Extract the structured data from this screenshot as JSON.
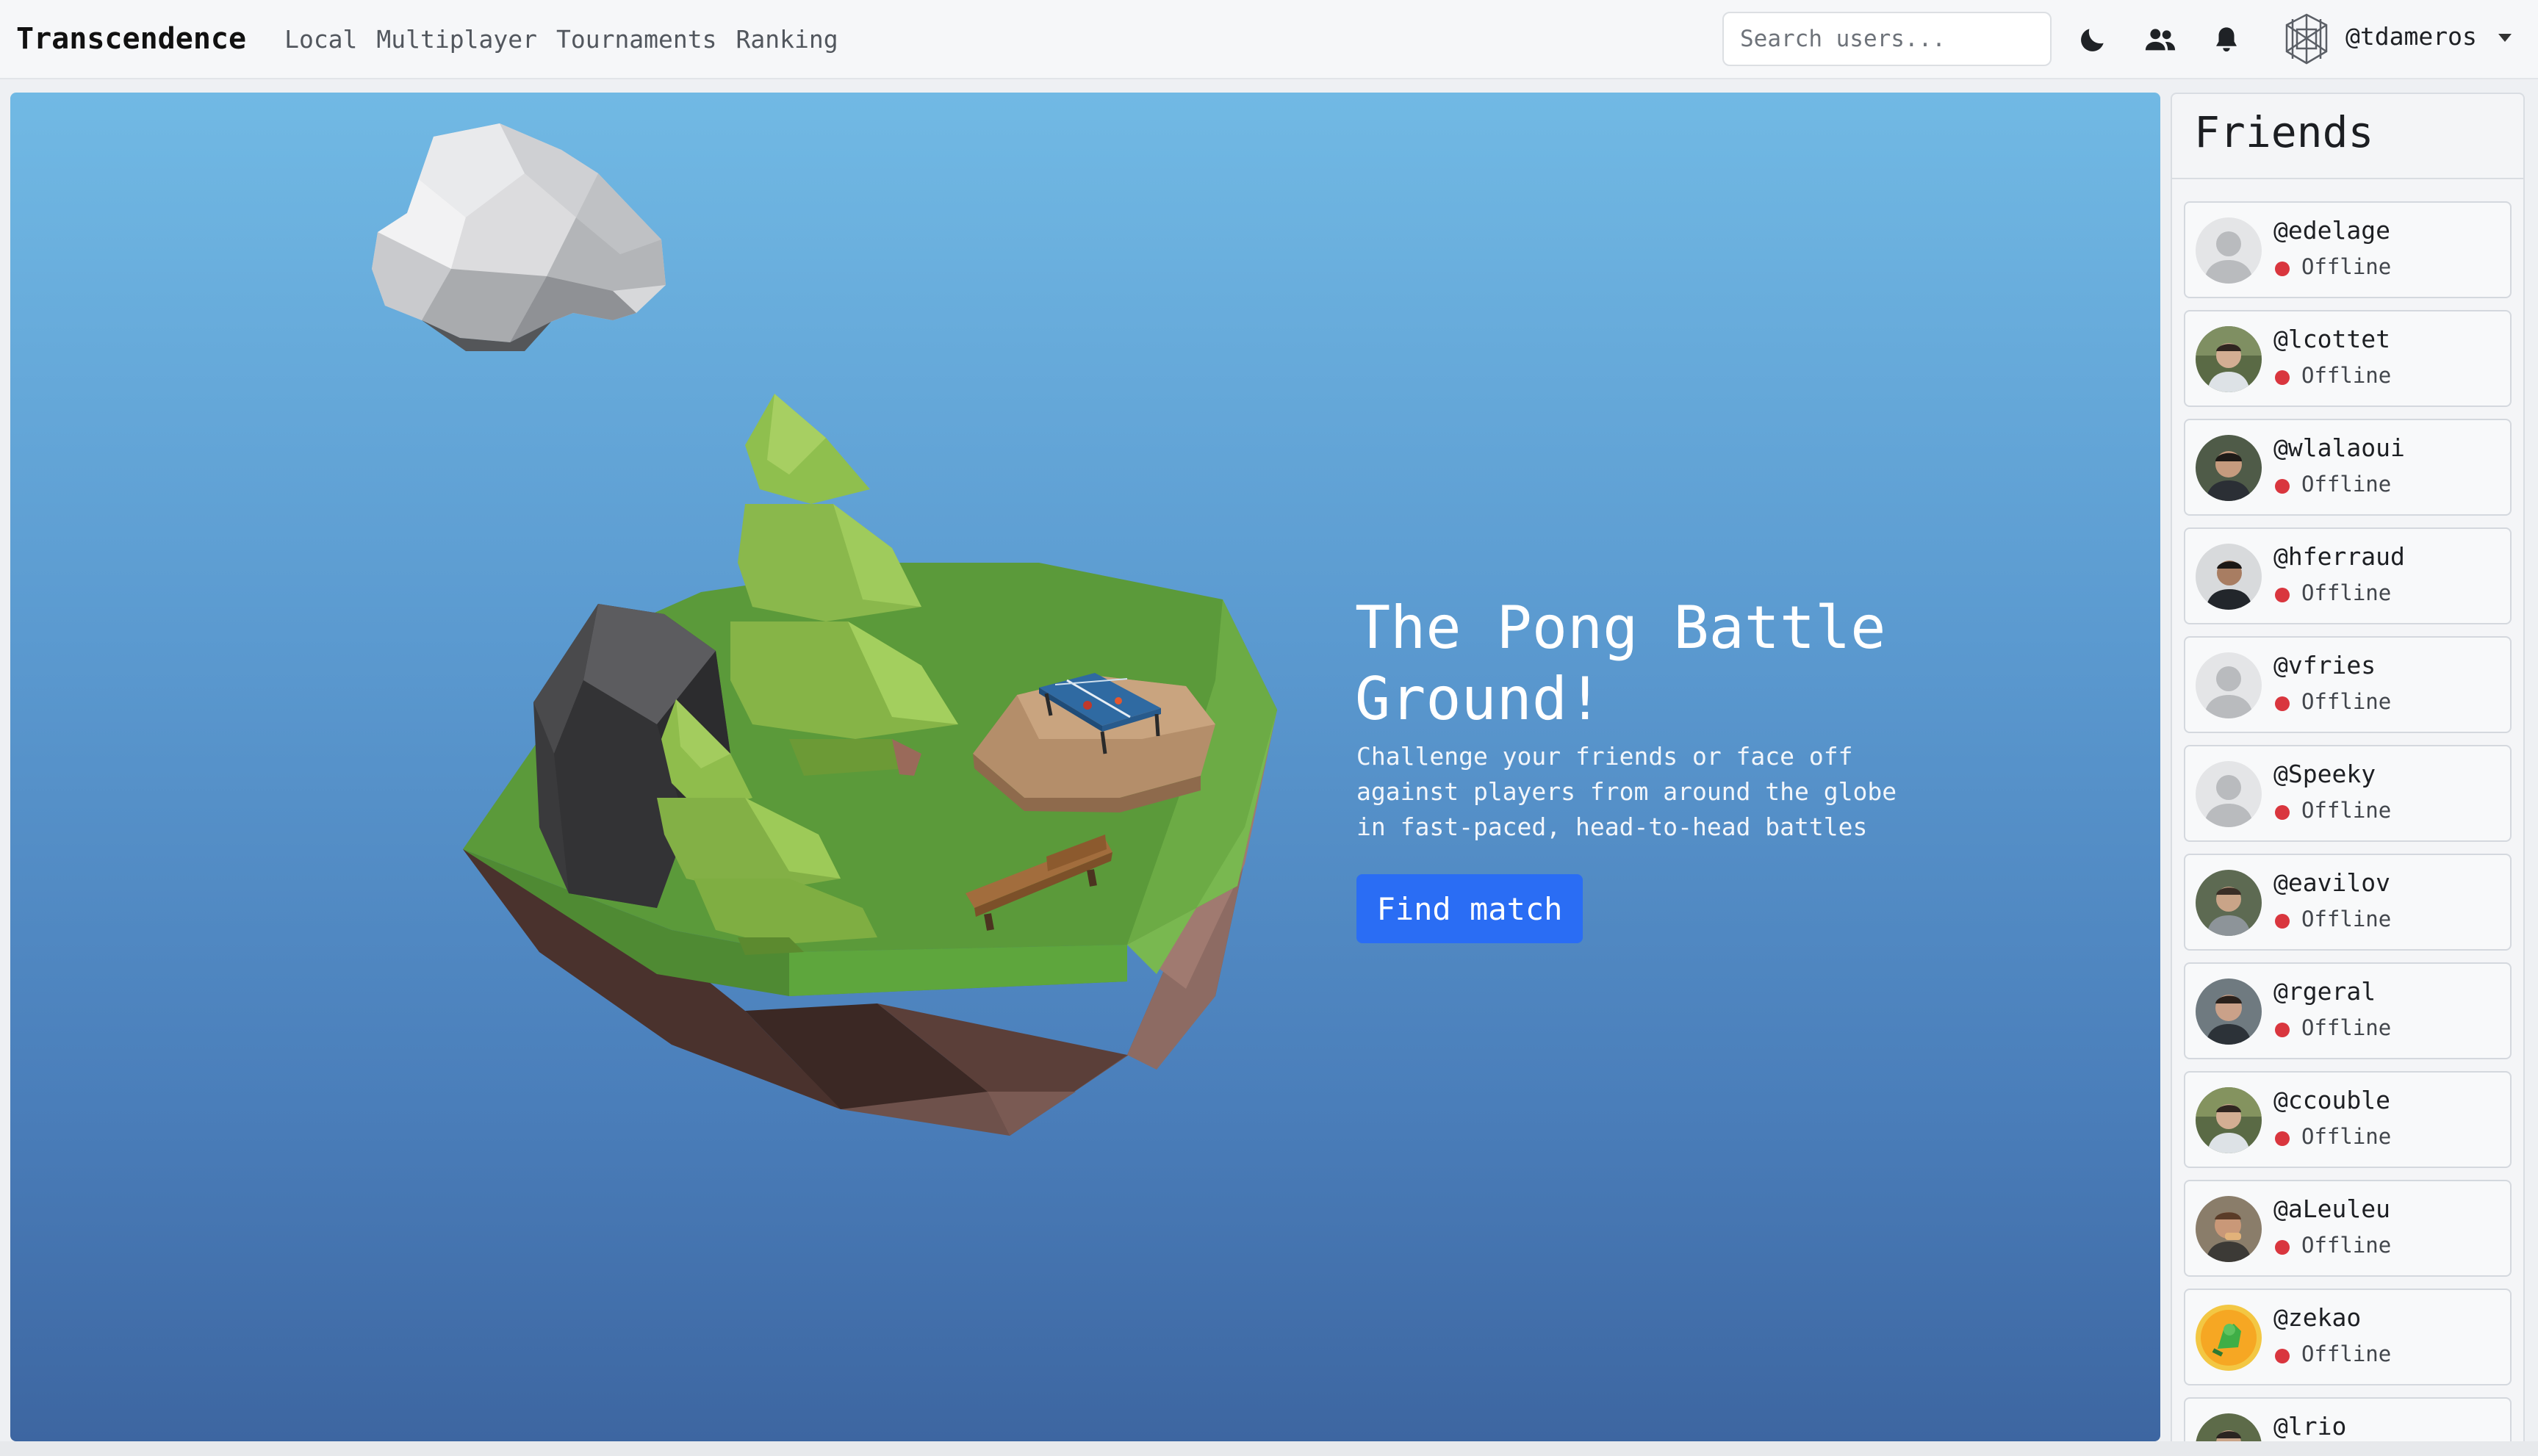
{
  "app": {
    "brand": "Transcendence"
  },
  "nav": {
    "links": [
      "Local",
      "Multiplayer",
      "Tournaments",
      "Ranking"
    ]
  },
  "search": {
    "placeholder": "Search users..."
  },
  "user": {
    "handle": "@tdameros"
  },
  "icons": {
    "theme": "moon-icon",
    "friends": "users-icon",
    "notifications": "bell-icon",
    "avatar": "cube-identicon"
  },
  "hero": {
    "title": "The Pong Battle Ground!",
    "subtitle": "Challenge your friends or face off against players from around the globe in fast-paced, head-to-head battles",
    "button": "Find match"
  },
  "friends": {
    "title": "Friends",
    "list": [
      {
        "name": "@edelage",
        "status": "Offline",
        "avatar": "placeholder"
      },
      {
        "name": "@lcottet",
        "status": "Offline",
        "avatar": "photo"
      },
      {
        "name": "@wlalaoui",
        "status": "Offline",
        "avatar": "photo"
      },
      {
        "name": "@hferraud",
        "status": "Offline",
        "avatar": "photo"
      },
      {
        "name": "@vfries",
        "status": "Offline",
        "avatar": "placeholder"
      },
      {
        "name": "@Speeky",
        "status": "Offline",
        "avatar": "placeholder"
      },
      {
        "name": "@eavilov",
        "status": "Offline",
        "avatar": "photo"
      },
      {
        "name": "@rgeral",
        "status": "Offline",
        "avatar": "photo"
      },
      {
        "name": "@ccouble",
        "status": "Offline",
        "avatar": "photo"
      },
      {
        "name": "@aLeuleu",
        "status": "Offline",
        "avatar": "photo"
      },
      {
        "name": "@zekao",
        "status": "Offline",
        "avatar": "cartoon"
      },
      {
        "name": "@lrio",
        "status": "",
        "avatar": "photo"
      }
    ]
  },
  "colors": {
    "accent": "#2a6df4",
    "offline": "#d9363e",
    "sky_top": "#71b9e4",
    "sky_bottom": "#3d66a1"
  }
}
